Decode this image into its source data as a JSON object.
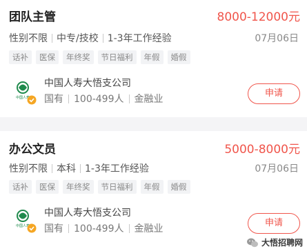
{
  "colors": {
    "salary": "#f0554b",
    "accent": "#f0554b",
    "badge": "#f5a623",
    "logo_green": "#1f8a4c"
  },
  "jobs": [
    {
      "title": "团队主管",
      "salary": "8000-12000元",
      "meta": [
        "性别不限",
        "中专/技校",
        "1-3年工作经验"
      ],
      "date": "07月06日",
      "tags": [
        "话补",
        "医保",
        "年终奖",
        "节日福利",
        "年假",
        "婚假"
      ],
      "company": "中国人寿大悟支公司",
      "company_meta": [
        "国有",
        "100-499人",
        "金融业"
      ],
      "apply_label": "申请",
      "logo_text": "中国人寿"
    },
    {
      "title": "办公文员",
      "salary": "5000-8000元",
      "meta": [
        "性别不限",
        "本科",
        "1-3年工作经验"
      ],
      "date": "07月06日",
      "tags": [
        "话补",
        "医保",
        "年终奖",
        "节日福利",
        "年假",
        "婚假"
      ],
      "company": "中国人寿大悟支公司",
      "company_meta": [
        "国有",
        "100-499人",
        "金融业"
      ],
      "apply_label": "申请",
      "logo_text": "中国人寿"
    }
  ],
  "watermark": {
    "text": "大悟招聘网",
    "icon": "wechat-icon"
  }
}
